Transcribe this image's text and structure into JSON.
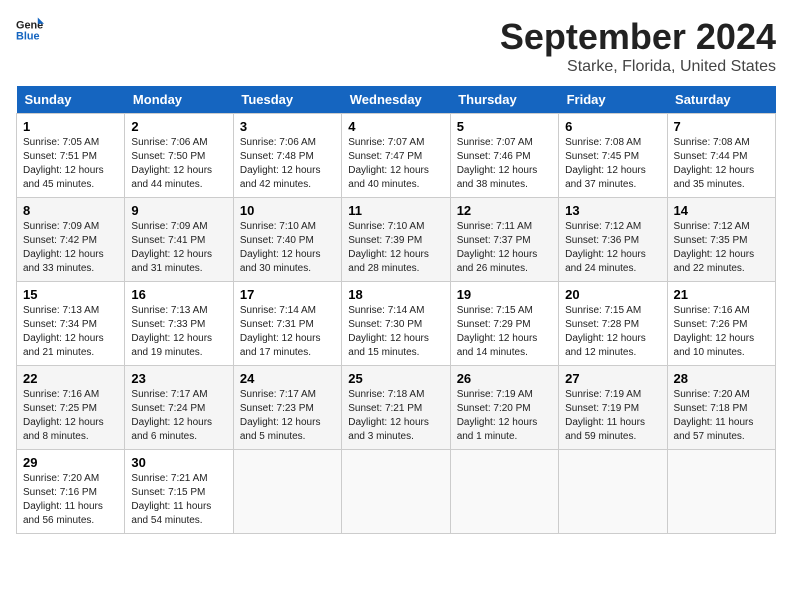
{
  "logo": {
    "line1": "General",
    "line2": "Blue"
  },
  "title": "September 2024",
  "location": "Starke, Florida, United States",
  "headers": [
    "Sunday",
    "Monday",
    "Tuesday",
    "Wednesday",
    "Thursday",
    "Friday",
    "Saturday"
  ],
  "weeks": [
    [
      {
        "day": "1",
        "sunrise": "Sunrise: 7:05 AM",
        "sunset": "Sunset: 7:51 PM",
        "daylight": "Daylight: 12 hours and 45 minutes."
      },
      {
        "day": "2",
        "sunrise": "Sunrise: 7:06 AM",
        "sunset": "Sunset: 7:50 PM",
        "daylight": "Daylight: 12 hours and 44 minutes."
      },
      {
        "day": "3",
        "sunrise": "Sunrise: 7:06 AM",
        "sunset": "Sunset: 7:48 PM",
        "daylight": "Daylight: 12 hours and 42 minutes."
      },
      {
        "day": "4",
        "sunrise": "Sunrise: 7:07 AM",
        "sunset": "Sunset: 7:47 PM",
        "daylight": "Daylight: 12 hours and 40 minutes."
      },
      {
        "day": "5",
        "sunrise": "Sunrise: 7:07 AM",
        "sunset": "Sunset: 7:46 PM",
        "daylight": "Daylight: 12 hours and 38 minutes."
      },
      {
        "day": "6",
        "sunrise": "Sunrise: 7:08 AM",
        "sunset": "Sunset: 7:45 PM",
        "daylight": "Daylight: 12 hours and 37 minutes."
      },
      {
        "day": "7",
        "sunrise": "Sunrise: 7:08 AM",
        "sunset": "Sunset: 7:44 PM",
        "daylight": "Daylight: 12 hours and 35 minutes."
      }
    ],
    [
      {
        "day": "8",
        "sunrise": "Sunrise: 7:09 AM",
        "sunset": "Sunset: 7:42 PM",
        "daylight": "Daylight: 12 hours and 33 minutes."
      },
      {
        "day": "9",
        "sunrise": "Sunrise: 7:09 AM",
        "sunset": "Sunset: 7:41 PM",
        "daylight": "Daylight: 12 hours and 31 minutes."
      },
      {
        "day": "10",
        "sunrise": "Sunrise: 7:10 AM",
        "sunset": "Sunset: 7:40 PM",
        "daylight": "Daylight: 12 hours and 30 minutes."
      },
      {
        "day": "11",
        "sunrise": "Sunrise: 7:10 AM",
        "sunset": "Sunset: 7:39 PM",
        "daylight": "Daylight: 12 hours and 28 minutes."
      },
      {
        "day": "12",
        "sunrise": "Sunrise: 7:11 AM",
        "sunset": "Sunset: 7:37 PM",
        "daylight": "Daylight: 12 hours and 26 minutes."
      },
      {
        "day": "13",
        "sunrise": "Sunrise: 7:12 AM",
        "sunset": "Sunset: 7:36 PM",
        "daylight": "Daylight: 12 hours and 24 minutes."
      },
      {
        "day": "14",
        "sunrise": "Sunrise: 7:12 AM",
        "sunset": "Sunset: 7:35 PM",
        "daylight": "Daylight: 12 hours and 22 minutes."
      }
    ],
    [
      {
        "day": "15",
        "sunrise": "Sunrise: 7:13 AM",
        "sunset": "Sunset: 7:34 PM",
        "daylight": "Daylight: 12 hours and 21 minutes."
      },
      {
        "day": "16",
        "sunrise": "Sunrise: 7:13 AM",
        "sunset": "Sunset: 7:33 PM",
        "daylight": "Daylight: 12 hours and 19 minutes."
      },
      {
        "day": "17",
        "sunrise": "Sunrise: 7:14 AM",
        "sunset": "Sunset: 7:31 PM",
        "daylight": "Daylight: 12 hours and 17 minutes."
      },
      {
        "day": "18",
        "sunrise": "Sunrise: 7:14 AM",
        "sunset": "Sunset: 7:30 PM",
        "daylight": "Daylight: 12 hours and 15 minutes."
      },
      {
        "day": "19",
        "sunrise": "Sunrise: 7:15 AM",
        "sunset": "Sunset: 7:29 PM",
        "daylight": "Daylight: 12 hours and 14 minutes."
      },
      {
        "day": "20",
        "sunrise": "Sunrise: 7:15 AM",
        "sunset": "Sunset: 7:28 PM",
        "daylight": "Daylight: 12 hours and 12 minutes."
      },
      {
        "day": "21",
        "sunrise": "Sunrise: 7:16 AM",
        "sunset": "Sunset: 7:26 PM",
        "daylight": "Daylight: 12 hours and 10 minutes."
      }
    ],
    [
      {
        "day": "22",
        "sunrise": "Sunrise: 7:16 AM",
        "sunset": "Sunset: 7:25 PM",
        "daylight": "Daylight: 12 hours and 8 minutes."
      },
      {
        "day": "23",
        "sunrise": "Sunrise: 7:17 AM",
        "sunset": "Sunset: 7:24 PM",
        "daylight": "Daylight: 12 hours and 6 minutes."
      },
      {
        "day": "24",
        "sunrise": "Sunrise: 7:17 AM",
        "sunset": "Sunset: 7:23 PM",
        "daylight": "Daylight: 12 hours and 5 minutes."
      },
      {
        "day": "25",
        "sunrise": "Sunrise: 7:18 AM",
        "sunset": "Sunset: 7:21 PM",
        "daylight": "Daylight: 12 hours and 3 minutes."
      },
      {
        "day": "26",
        "sunrise": "Sunrise: 7:19 AM",
        "sunset": "Sunset: 7:20 PM",
        "daylight": "Daylight: 12 hours and 1 minute."
      },
      {
        "day": "27",
        "sunrise": "Sunrise: 7:19 AM",
        "sunset": "Sunset: 7:19 PM",
        "daylight": "Daylight: 11 hours and 59 minutes."
      },
      {
        "day": "28",
        "sunrise": "Sunrise: 7:20 AM",
        "sunset": "Sunset: 7:18 PM",
        "daylight": "Daylight: 11 hours and 57 minutes."
      }
    ],
    [
      {
        "day": "29",
        "sunrise": "Sunrise: 7:20 AM",
        "sunset": "Sunset: 7:16 PM",
        "daylight": "Daylight: 11 hours and 56 minutes."
      },
      {
        "day": "30",
        "sunrise": "Sunrise: 7:21 AM",
        "sunset": "Sunset: 7:15 PM",
        "daylight": "Daylight: 11 hours and 54 minutes."
      },
      null,
      null,
      null,
      null,
      null
    ]
  ]
}
